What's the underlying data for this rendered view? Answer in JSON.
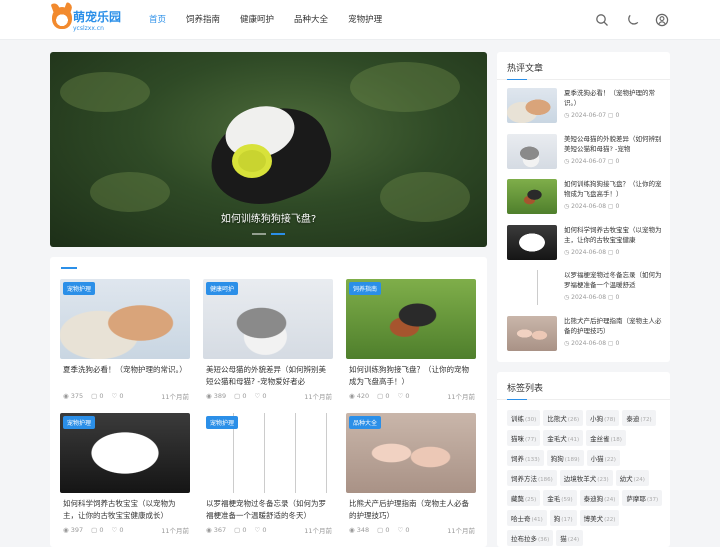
{
  "header": {
    "logo_title": "萌宠乐园",
    "logo_domain": "ycslzxx.cn",
    "nav": [
      "首页",
      "饲养指南",
      "健康呵护",
      "品种大全",
      "宠物护理"
    ],
    "active_index": 0,
    "icons": [
      "search-icon",
      "moon-icon",
      "user-icon"
    ],
    "accent": "#2b8fe8"
  },
  "banner": {
    "caption": "如何训练狗狗接飞盘?",
    "slides": 2,
    "active_slide": 1
  },
  "articles": [
    {
      "tag": "宠物护理",
      "title": "夏季洗狗必看！（宠物护理的常识。）",
      "views": "375",
      "comments": "0",
      "likes": "0",
      "time": "11个月前",
      "img": "puppy-bath"
    },
    {
      "tag": "健康呵护",
      "title": "美短公母猫的外貌差异（如何辨别美短公猫和母猫? -宠物爱好者必",
      "views": "389",
      "comments": "0",
      "likes": "0",
      "time": "11个月前",
      "img": "cats"
    },
    {
      "tag": "饲养指南",
      "title": "如何训练狗狗接飞盘？（让你的宠物成为飞盘高手！）",
      "views": "420",
      "comments": "0",
      "likes": "0",
      "time": "11个月前",
      "img": "dog-frisbee"
    },
    {
      "tag": "宠物护理",
      "title": "如何科学饲养古牧宝宝（以宠物为主，让你的古牧宝宝健康成长）",
      "views": "397",
      "comments": "0",
      "likes": "0",
      "time": "11个月前",
      "img": "white-puppy"
    },
    {
      "tag": "宠物护理",
      "title": "以罗福梗宠物过冬备忘录（如何为罗福梗准备一个温暖舒适的冬天）",
      "views": "367",
      "comments": "0",
      "likes": "0",
      "time": "11个月前",
      "img": "comic"
    },
    {
      "tag": "品种大全",
      "title": "比熊犬产后护理指南（宠物主人必备的护理技巧）",
      "views": "348",
      "comments": "0",
      "likes": "0",
      "time": "11个月前",
      "img": "newborn"
    }
  ],
  "hot": {
    "title": "热评文章",
    "items": [
      {
        "title": "夏季洗狗必看！（宠物护理的常识。）",
        "date": "2024-06-07",
        "comments": "0",
        "img": "puppy-bath"
      },
      {
        "title": "美短公母猫的外貌差异（如何辨别美短公猫和母猫? -宠物",
        "date": "2024-06-07",
        "comments": "0",
        "img": "cats"
      },
      {
        "title": "如何训练狗狗接飞盘？（让你的宠物成为飞盘高手！）",
        "date": "2024-06-08",
        "comments": "0",
        "img": "dog-frisbee"
      },
      {
        "title": "如何科学饲养古牧宝宝（以宠物为主，让你的古牧宝宝健康",
        "date": "2024-06-08",
        "comments": "0",
        "img": "white-puppy"
      },
      {
        "title": "以罗福梗宠物过冬备忘录（如何为罗福梗准备一个温暖舒适",
        "date": "2024-06-08",
        "comments": "0",
        "img": "comic"
      },
      {
        "title": "比熊犬产后护理指南（宠物主人必备的护理技巧）",
        "date": "2024-06-08",
        "comments": "0",
        "img": "newborn"
      }
    ]
  },
  "tags": {
    "title": "标签列表",
    "items": [
      {
        "name": "训练",
        "count": "30"
      },
      {
        "name": "比熊犬",
        "count": "26"
      },
      {
        "name": "小狗",
        "count": "78"
      },
      {
        "name": "泰迪",
        "count": "72"
      },
      {
        "name": "猫咪",
        "count": "77"
      },
      {
        "name": "金毛犬",
        "count": "41"
      },
      {
        "name": "金丝雀",
        "count": "18"
      },
      {
        "name": "饲养",
        "count": "133"
      },
      {
        "name": "狗狗",
        "count": "189"
      },
      {
        "name": "小猫",
        "count": "22"
      },
      {
        "name": "饲养方法",
        "count": "186"
      },
      {
        "name": "边境牧羊犬",
        "count": "23"
      },
      {
        "name": "幼犬",
        "count": "24"
      },
      {
        "name": "藏獒",
        "count": "25"
      },
      {
        "name": "金毛",
        "count": "59"
      },
      {
        "name": "泰迪狗",
        "count": "24"
      },
      {
        "name": "萨摩耶",
        "count": "37"
      },
      {
        "name": "哈士奇",
        "count": "41"
      },
      {
        "name": "狗",
        "count": "17"
      },
      {
        "name": "博美犬",
        "count": "22"
      },
      {
        "name": "拉布拉多",
        "count": "36"
      },
      {
        "name": "猫",
        "count": "24"
      }
    ]
  }
}
